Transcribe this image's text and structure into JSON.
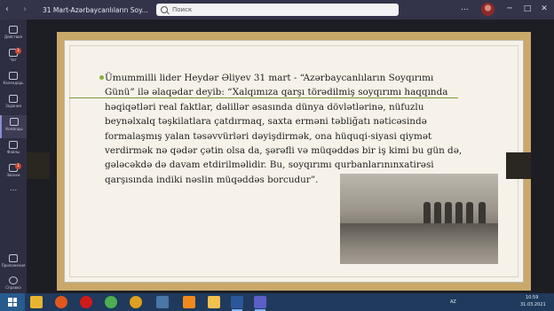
{
  "window": {
    "title": "31 Mart-Azərbaycanlıların Soy...",
    "search_placeholder": "Поиск",
    "more": "...",
    "minimize": "─",
    "maximize": "□",
    "close": "✕",
    "back": "‹",
    "forward": "›"
  },
  "rail": {
    "items": [
      {
        "label": "Действия",
        "icon": "bell-icon",
        "badge": ""
      },
      {
        "label": "Чат",
        "icon": "chat-icon",
        "badge": "1"
      },
      {
        "label": "Календарь",
        "icon": "calendar-icon",
        "badge": ""
      },
      {
        "label": "Задания",
        "icon": "assignments-icon",
        "badge": ""
      },
      {
        "label": "Команды",
        "icon": "teams-icon",
        "badge": ""
      },
      {
        "label": "Файлы",
        "icon": "files-icon",
        "badge": ""
      },
      {
        "label": "Звонки",
        "icon": "calls-icon",
        "badge": "1"
      }
    ],
    "more": "...",
    "bottom_items": [
      {
        "label": "Приложения",
        "icon": "apps-icon"
      },
      {
        "label": "Справка",
        "icon": "help-icon"
      }
    ]
  },
  "slide": {
    "lines": [
      "Ümummilli lider Heydər Əliyev 31 mart - “Azərbaycanlıların Soyqırımı",
      "Günü” ilə əlaqədar deyib: “Xalqımıza qarşı törədilmiş soyqırımı haqqında",
      "həqiqətləri real faktlar, dəlillər əsasında dünya dövlətlərinə, nüfuzlu",
      "beynəlxalq təşkilatlara çatdırmaq, saxta erməni təbliğatı nəticəsində",
      "formalaşmış yalan təsəvvürləri dəyişdirmək, ona hüquqi-siyasi qiymət",
      "verdirmək nə qədər çətin olsa da, şərəfli və müqəddəs bir iş kimi bu gün də,",
      "gələcəkdə də davam etdirilməlidir. Bu, soyqırımı qurbanlarınınxatirəsi",
      "qarşısında indiki nəslin müqəddəs borcudur”."
    ]
  },
  "taskbar": {
    "apps": [
      "explorer",
      "firefox",
      "opera",
      "chrome-old",
      "chrome",
      "vk",
      "odnoklassniki",
      "files",
      "word",
      "teams"
    ],
    "lang": "AZ",
    "time": "10:59",
    "date": "31.03.2021"
  }
}
